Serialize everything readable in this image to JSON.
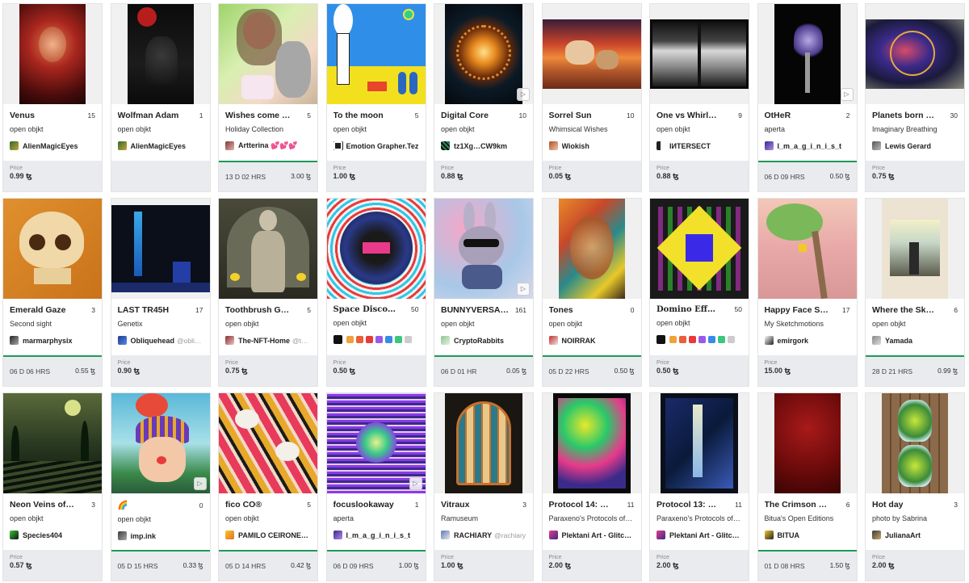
{
  "currency": "ꜩ",
  "price_label": "Price",
  "cards": [
    {
      "title": "Venus",
      "editions": "15",
      "collection": "open objkt",
      "artist": "AlienMagicEyes",
      "price": "0.99 ꜩ"
    },
    {
      "title": "Wolfman Adam",
      "editions": "1",
      "collection": "open objkt",
      "artist": "AlienMagicEyes"
    },
    {
      "title": "Wishes come …",
      "editions": "5",
      "collection": "Holiday Collection",
      "artist": "Artterina 💕💕💕",
      "timer": "13 D  02 HRS",
      "timer_price": "3.00 ꜩ"
    },
    {
      "title": "To the moon",
      "editions": "5",
      "collection": "open objkt",
      "artist": "Emotion Grapher.Tez",
      "price": "1.00 ꜩ"
    },
    {
      "title": "Digital Core",
      "editions": "10",
      "collection": "open objkt",
      "artist": "tz1Xg…CW9km",
      "price": "0.88 ꜩ"
    },
    {
      "title": "Sorrel Sun",
      "editions": "10",
      "collection": "Whimsical Wishes",
      "artist": "Wiokish",
      "price": "0.05 ꜩ"
    },
    {
      "title": "One vs Whirl…",
      "editions": "9",
      "collection": "open objkt",
      "artist": "ΙИΤΕRЅΕСΤ",
      "price": "0.88 ꜩ"
    },
    {
      "title": "OtHeR",
      "editions": "2",
      "collection": "aperta",
      "artist": "I_m_a_g_i_n_i_s_t",
      "timer": "06 D  09 HRS",
      "timer_price": "0.50 ꜩ"
    },
    {
      "title": "Planets born …",
      "editions": "30",
      "collection": "Imaginary Breathing",
      "artist": "Lewis Gerard",
      "price": "0.75 ꜩ"
    },
    {
      "title": "Emerald Gaze",
      "editions": "3",
      "collection": "Second sight",
      "artist": "marmarphysix",
      "timer": "06 D  06 HRS",
      "timer_price": "0.55 ꜩ"
    },
    {
      "title": "LAST TR45H",
      "editions": "17",
      "collection": "Genetix",
      "artist": "Obliquehead",
      "handle": "@obli…",
      "price": "0.90 ꜩ"
    },
    {
      "title": "Toothbrush G…",
      "editions": "5",
      "collection": "open objkt",
      "artist": "The-NFT-Home",
      "handle": "@t…",
      "price": "0.75 ꜩ"
    },
    {
      "title": "Space Disco…",
      "editions": "50",
      "collection": "open objkt",
      "artist": "",
      "price": "0.50 ꜩ"
    },
    {
      "title": "BUNNYVERSA…",
      "editions": "161",
      "collection": "open objkt",
      "artist": "CryptoRabbits",
      "timer": "06 D  01 HR",
      "timer_price": "0.05 ꜩ"
    },
    {
      "title": "Tones",
      "editions": "0",
      "collection": "open objkt",
      "artist": "NOIRRAK",
      "timer": "05 D  22 HRS",
      "timer_price": "0.50 ꜩ"
    },
    {
      "title": "Domino Eff…",
      "editions": "50",
      "collection": "open objkt",
      "artist": "",
      "price": "0.50 ꜩ"
    },
    {
      "title": "Happy Face S…",
      "editions": "17",
      "collection": "My Sketchmotions",
      "artist": "emirgork",
      "price": "15.00 ꜩ"
    },
    {
      "title": "Where the Sk…",
      "editions": "6",
      "collection": "open objkt",
      "artist": "Yamada",
      "timer": "28 D  21 HRS",
      "timer_price": "0.99 ꜩ"
    },
    {
      "title": "Neon Veins of…",
      "editions": "3",
      "collection": "open objkt",
      "artist": "Species404",
      "price": "0.57 ꜩ"
    },
    {
      "title": "🌈",
      "editions": "0",
      "collection": "open objkt",
      "artist": "imp.ink",
      "timer": "05 D  15 HRS",
      "timer_price": "0.33 ꜩ"
    },
    {
      "title": "fico CO®",
      "editions": "5",
      "collection": "open objkt",
      "artist": "PAMILO CEIRONE®…",
      "timer": "05 D  14 HRS",
      "timer_price": "0.42 ꜩ"
    },
    {
      "title": "focuslookaway",
      "editions": "1",
      "collection": "aperta",
      "artist": "I_m_a_g_i_n_i_s_t",
      "timer": "06 D  09 HRS",
      "timer_price": "1.00 ꜩ"
    },
    {
      "title": "Vitraux",
      "editions": "3",
      "collection": "Ramuseum",
      "artist": "RACHIARY",
      "handle": "@rachiary",
      "price": "1.00 ꜩ"
    },
    {
      "title": "Protocol 14: …",
      "editions": "11",
      "collection": "Paraxeno's Protocols of L…",
      "artist": "Plektani Art - Glitc…",
      "price": "2.00 ꜩ"
    },
    {
      "title": "Protocol 13: …",
      "editions": "11",
      "collection": "Paraxeno's Protocols of L…",
      "artist": "Plektani Art - Glitc…",
      "price": "2.00 ꜩ"
    },
    {
      "title": "The Crimson …",
      "editions": "6",
      "collection": "Bitua's Open Editions",
      "artist": "BITUA",
      "timer": "01 D  08 HRS",
      "timer_price": "1.50 ꜩ"
    },
    {
      "title": "Hot day",
      "editions": "3",
      "collection": "photo by Sabrina",
      "artist": "JulianaArt",
      "price": "2.00 ꜩ"
    }
  ]
}
